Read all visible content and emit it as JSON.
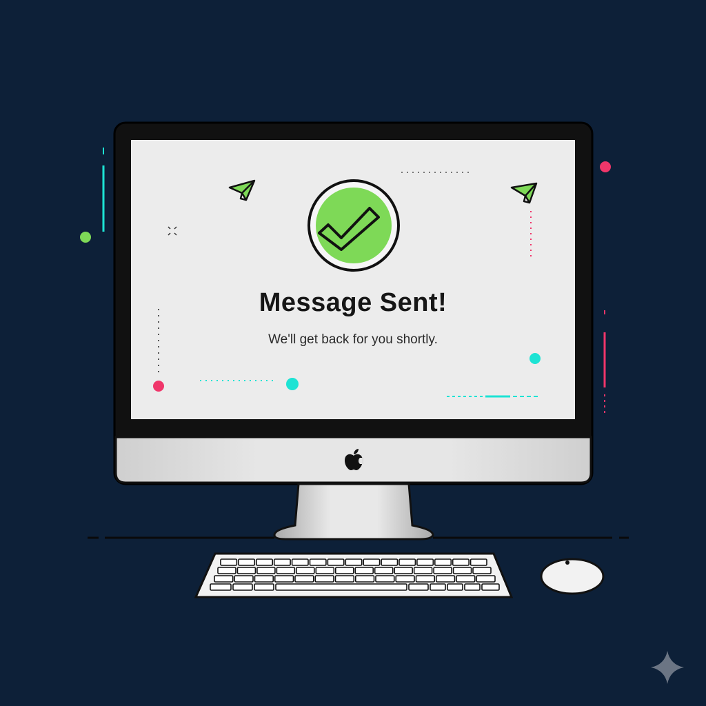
{
  "screen": {
    "title": "Message Sent!",
    "subtitle": "We'll get back for you shortly."
  },
  "icons": {
    "status": "check-circle-icon",
    "decor": "paper-plane-icon",
    "brand": "apple-logo-icon",
    "watermark": "sparkle-icon"
  },
  "colors": {
    "background": "#0d2038",
    "success": "#7ed957",
    "accent_cyan": "#1de3d4",
    "accent_pink": "#f0366a",
    "accent_green": "#7ed957",
    "screen": "#ececec"
  }
}
